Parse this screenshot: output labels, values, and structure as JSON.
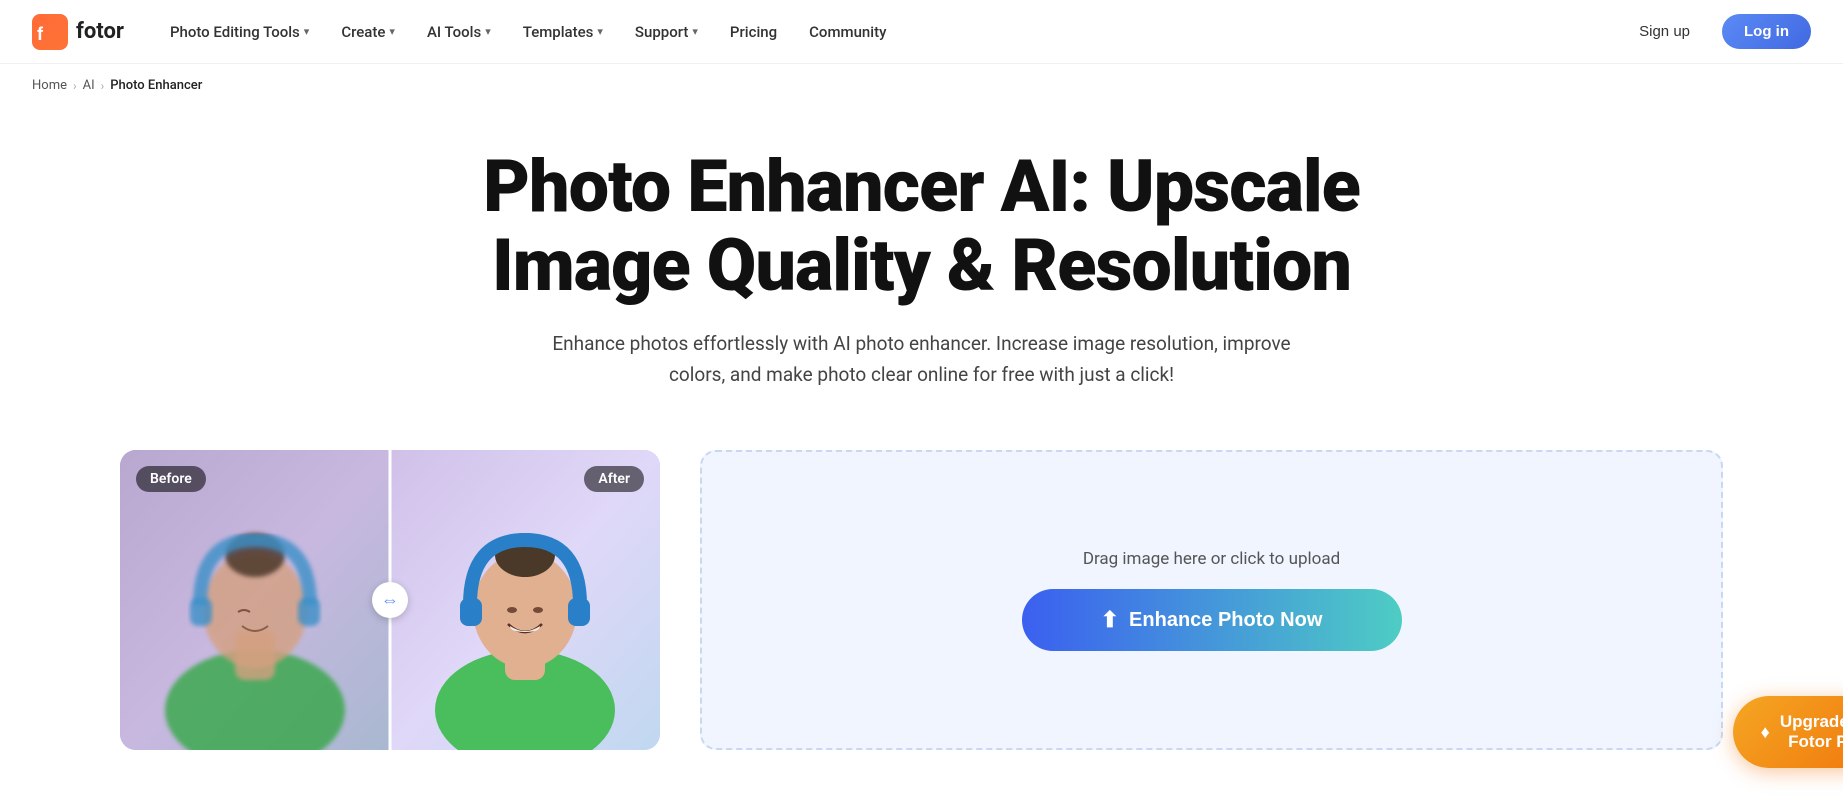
{
  "brand": {
    "name": "fotor",
    "logo_alt": "Fotor logo"
  },
  "navbar": {
    "items": [
      {
        "label": "Photo Editing Tools",
        "has_dropdown": true
      },
      {
        "label": "Create",
        "has_dropdown": true
      },
      {
        "label": "AI Tools",
        "has_dropdown": true
      },
      {
        "label": "Templates",
        "has_dropdown": true
      },
      {
        "label": "Support",
        "has_dropdown": true
      },
      {
        "label": "Pricing",
        "has_dropdown": false
      },
      {
        "label": "Community",
        "has_dropdown": false
      }
    ],
    "signup_label": "Sign up",
    "login_label": "Log in"
  },
  "breadcrumb": {
    "items": [
      {
        "label": "Home",
        "link": true
      },
      {
        "label": "AI",
        "link": true
      },
      {
        "label": "Photo Enhancer",
        "link": false
      }
    ]
  },
  "hero": {
    "title": "Photo Enhancer AI: Upscale Image Quality & Resolution",
    "subtitle": "Enhance photos effortlessly with AI photo enhancer. Increase image resolution, improve colors, and make photo clear online for free with just a click!"
  },
  "before_after": {
    "before_label": "Before",
    "after_label": "After"
  },
  "upload": {
    "drag_text": "Drag image here or click to upload",
    "enhance_button_label": "Enhance Photo Now",
    "upload_icon": "⬆"
  },
  "upgrade": {
    "label": "Upgrade To\nFotor Pro",
    "diamond_icon": "♦"
  },
  "colors": {
    "brand_blue": "#4169e1",
    "gradient_enhance_start": "#3b5ff0",
    "gradient_enhance_end": "#4ecdc4",
    "gradient_upgrade_start": "#f5a623",
    "gradient_upgrade_end": "#f0730a",
    "upload_bg": "#f0f5ff",
    "upload_border": "#c8d8f0"
  }
}
